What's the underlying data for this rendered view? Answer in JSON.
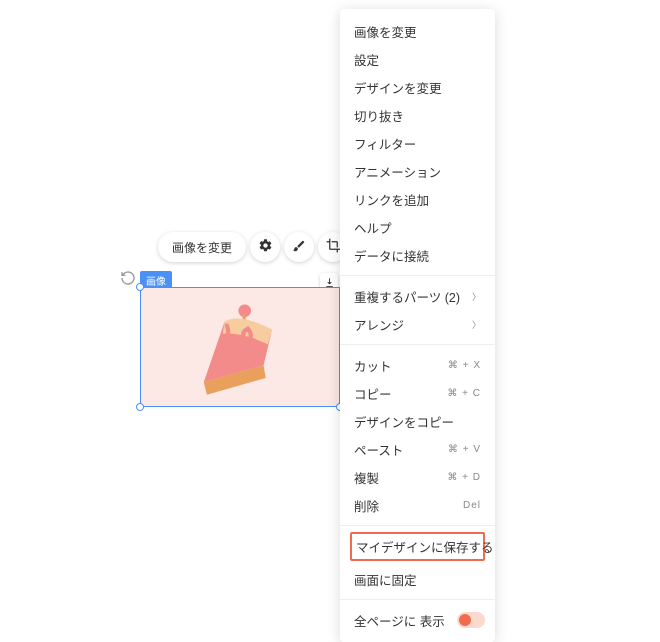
{
  "toolbar": {
    "change_image": "画像を変更"
  },
  "selection": {
    "tag": "画像"
  },
  "menu": {
    "change_image": "画像を変更",
    "settings": "設定",
    "change_design": "デザインを変更",
    "crop": "切り抜き",
    "filter": "フィルター",
    "animation": "アニメーション",
    "add_link": "リンクを追加",
    "help": "ヘルプ",
    "connect_data": "データに接続",
    "duplicate_parts": "重複するパーツ (2)",
    "arrange": "アレンジ",
    "cut": "カット",
    "cut_key": "⌘ + X",
    "copy": "コピー",
    "copy_key": "⌘ + C",
    "copy_design": "デザインをコピー",
    "paste": "ペースト",
    "paste_key": "⌘ + V",
    "duplicate": "複製",
    "duplicate_key": "⌘ + D",
    "delete": "削除",
    "delete_key": "Del",
    "save_my_design": "マイデザインに保存する",
    "pin_screen": "画面に固定",
    "show_all_pages": "全ページに 表示"
  }
}
